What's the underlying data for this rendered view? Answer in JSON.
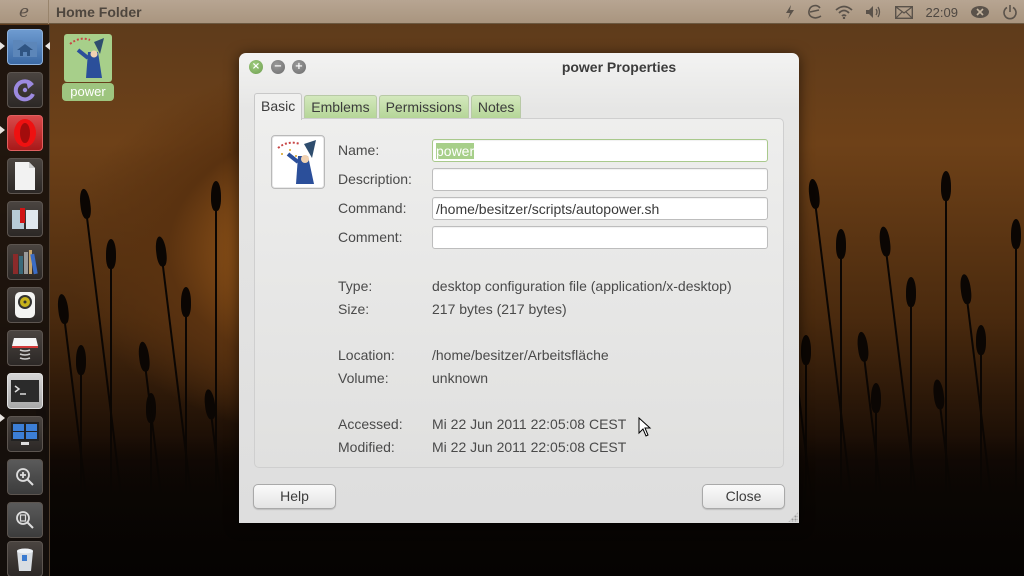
{
  "top_panel": {
    "logo_glyph": "e",
    "title": "Home Folder",
    "tray": [
      {
        "name": "power-indicator-icon",
        "glyph": "⚡"
      },
      {
        "name": "eco-logo-icon",
        "glyph": "ℯ"
      },
      {
        "name": "wifi-icon",
        "glyph": "◠"
      },
      {
        "name": "volume-icon",
        "glyph": "🔊"
      },
      {
        "name": "mail-icon",
        "glyph": "✉"
      },
      {
        "name": "chat-status-icon",
        "glyph": "⊗"
      },
      {
        "name": "power-button-icon",
        "glyph": "⏻"
      }
    ],
    "clock": "22:09"
  },
  "launcher": {
    "items": [
      {
        "name": "home-folder",
        "running": true
      },
      {
        "name": "update-manager",
        "running": false
      },
      {
        "name": "opera-browser",
        "running": true
      },
      {
        "name": "libreoffice",
        "running": false
      },
      {
        "name": "reader-app",
        "running": false
      },
      {
        "name": "library-app",
        "running": false
      },
      {
        "name": "audio-player",
        "running": false
      },
      {
        "name": "awning-app",
        "running": false
      },
      {
        "name": "terminal",
        "running": true
      },
      {
        "name": "workspace-switcher",
        "running": false
      },
      {
        "name": "zoom-in",
        "running": false
      },
      {
        "name": "zoom-fit",
        "running": false
      },
      {
        "name": "trash",
        "running": false
      }
    ]
  },
  "desktop": {
    "icon_label": "power"
  },
  "dialog": {
    "title": "power Properties",
    "tabs": [
      {
        "label": "Basic",
        "active": true
      },
      {
        "label": "Emblems",
        "active": false
      },
      {
        "label": "Permissions",
        "active": false
      },
      {
        "label": "Notes",
        "active": false
      }
    ],
    "fields": {
      "name": {
        "label": "Name:",
        "value": "power"
      },
      "description": {
        "label": "Description:",
        "value": ""
      },
      "command": {
        "label": "Command:",
        "value": "/home/besitzer/scripts/autopower.sh"
      },
      "comment": {
        "label": "Comment:",
        "value": ""
      }
    },
    "info": {
      "type": {
        "label": "Type:",
        "value": "desktop configuration file (application/x-desktop)"
      },
      "size": {
        "label": "Size:",
        "value": "217 bytes (217 bytes)"
      },
      "location": {
        "label": "Location:",
        "value": "/home/besitzer/Arbeitsfläche"
      },
      "volume": {
        "label": "Volume:",
        "value": "unknown"
      },
      "accessed": {
        "label": "Accessed:",
        "value": "Mi 22 Jun 2011 22:05:08 CEST"
      },
      "modified": {
        "label": "Modified:",
        "value": "Mi 22 Jun 2011 22:05:08 CEST"
      }
    },
    "buttons": {
      "help": "Help",
      "close": "Close"
    },
    "window_controls": {
      "close": "×",
      "minimize": "−",
      "maximize": "+"
    }
  },
  "colors": {
    "accent_green": "#a7cf8a",
    "tab_green": "#c4dfa9",
    "panel_bg": "#b1a08b"
  }
}
